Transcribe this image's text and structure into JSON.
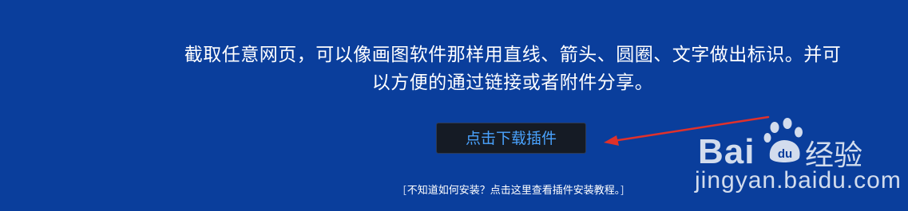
{
  "intro": {
    "text": "截取任意网页，可以像画图软件那样用直线、箭头、圆圈、文字做出标识。并可以方便的通过链接或者附件分享。"
  },
  "download": {
    "label": "点击下载插件"
  },
  "help": {
    "open_bracket": "[",
    "link_text": "不知道如何安装？点击这里查看插件安装教程。",
    "close_bracket": "]"
  },
  "watermark": {
    "brand": "Bai",
    "brand_suffix": "经验",
    "url": "jingyan.baidu.com",
    "paw_text": "du"
  },
  "colors": {
    "background": "#0a3e9c",
    "button_bg": "#151b25",
    "button_text": "#4aa3ff",
    "arrow": "#e0312b"
  },
  "icons": {
    "annotation": "arrow-icon",
    "watermark": "baidu-paw-icon"
  }
}
